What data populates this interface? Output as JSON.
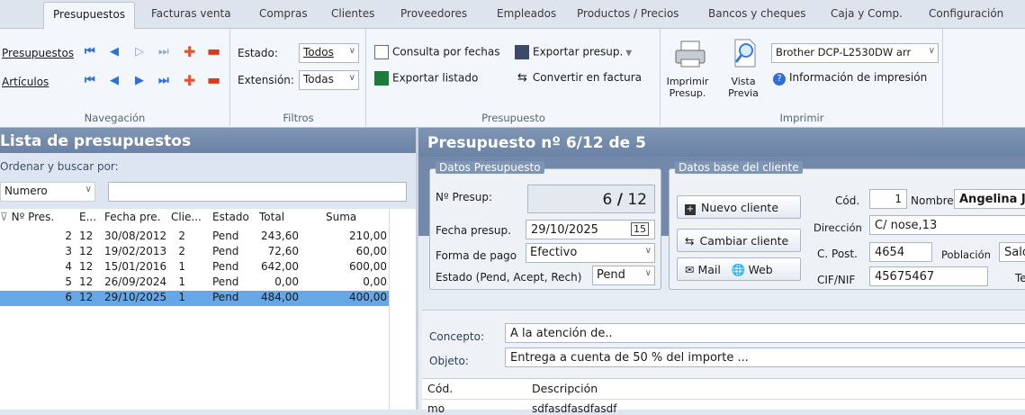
{
  "tabs": [
    "Presupuestos",
    "Facturas venta",
    "Compras",
    "Clientes",
    "Proveedores",
    "Empleados",
    "Productos / Precios",
    "Bancos y cheques",
    "Caja y Comp.",
    "Configuración"
  ],
  "ribbon": {
    "nav": {
      "title": "Navegación",
      "row1_label": "Presupuestos",
      "row2_label": "Artículos"
    },
    "filtros": {
      "title": "Filtros",
      "estado_label": "Estado:",
      "estado_value": "Todos",
      "extension_label": "Extensión:",
      "extension_value": "Todas"
    },
    "presupuesto": {
      "title": "Presupuesto",
      "consulta": "Consulta por fechas",
      "exportar_presup": "Exportar presup.",
      "exportar_listado": "Exportar listado",
      "convertir": "Convertir en factura"
    },
    "imprimir": {
      "title": "Imprimir",
      "imprimir_presup_1": "Imprimir",
      "imprimir_presup_2": "Presup.",
      "vista_previa_1": "Vista",
      "vista_previa_2": "Previa",
      "printer": "Brother DCP-L2530DW arr",
      "info": "Información de impresión"
    }
  },
  "list": {
    "title": "Lista de presupuestos",
    "sort_label": "Ordenar y buscar por:",
    "sort_value": "Numero",
    "search_value": "",
    "columns": [
      "Nº Pres.",
      "E...",
      "Fecha pre.",
      "Clie...",
      "Estado",
      "Total",
      "Suma"
    ],
    "rows": [
      {
        "n": "2",
        "e": "12",
        "fecha": "30/08/2012",
        "cli": "2",
        "estado": "Pend",
        "total": "243,60",
        "suma": "210,00"
      },
      {
        "n": "3",
        "e": "12",
        "fecha": "19/02/2013",
        "cli": "2",
        "estado": "Pend",
        "total": "72,60",
        "suma": "60,00"
      },
      {
        "n": "4",
        "e": "12",
        "fecha": "15/01/2016",
        "cli": "1",
        "estado": "Pend",
        "total": "642,00",
        "suma": "600,00"
      },
      {
        "n": "5",
        "e": "12",
        "fecha": "26/09/2024",
        "cli": "1",
        "estado": "Pend",
        "total": "0,00",
        "suma": "0,00"
      },
      {
        "n": "6",
        "e": "12",
        "fecha": "29/10/2025",
        "cli": "1",
        "estado": "Pend",
        "total": "484,00",
        "suma": "400,00"
      }
    ]
  },
  "detail": {
    "title": "Presupuesto nº 6/12 de 5",
    "datos_presupuesto": "Datos Presupuesto",
    "num_label": "Nº Presup:",
    "num_value": "6",
    "num_sep": "/",
    "num_ext": "12",
    "fecha_label": "Fecha presup.",
    "fecha_value": "29/10/2025",
    "pago_label": "Forma de pago",
    "pago_value": "Efectivo",
    "estado_label": "Estado (Pend, Acept, Rech)",
    "estado_value": "Pend",
    "datos_cliente": "Datos base del cliente",
    "nuevo_cliente": "Nuevo cliente",
    "cambiar_cliente": "Cambiar cliente",
    "mail": "Mail",
    "web": "Web",
    "cod_label": "Cód.",
    "cod_value": "1",
    "nombre_label": "Nombre",
    "nombre_value": "Angelina J",
    "direccion_label": "Dirección",
    "direccion_value": "C/ nose,13",
    "cpost_label": "C. Post.",
    "cpost_value": "4654",
    "poblacion_label": "Población",
    "poblacion_value": "Salol",
    "cif_label": "CIF/NIF",
    "cif_value": "45675467",
    "tel_label": "Telé",
    "concepto_label": "Concepto:",
    "concepto_value": "A la atención de..",
    "objeto_label": "Objeto:",
    "objeto_value": "Entrega a cuenta de 50 % del importe ...",
    "lines_col1": "Cód.",
    "lines_col2": "Descripción",
    "line1_cod": "mo",
    "line1_desc": "sdfasdfasdfasdf"
  },
  "colors": {
    "accent": "#2f6fd6",
    "selected_row": "#67a7e6",
    "title_bar": "#7289ab"
  }
}
